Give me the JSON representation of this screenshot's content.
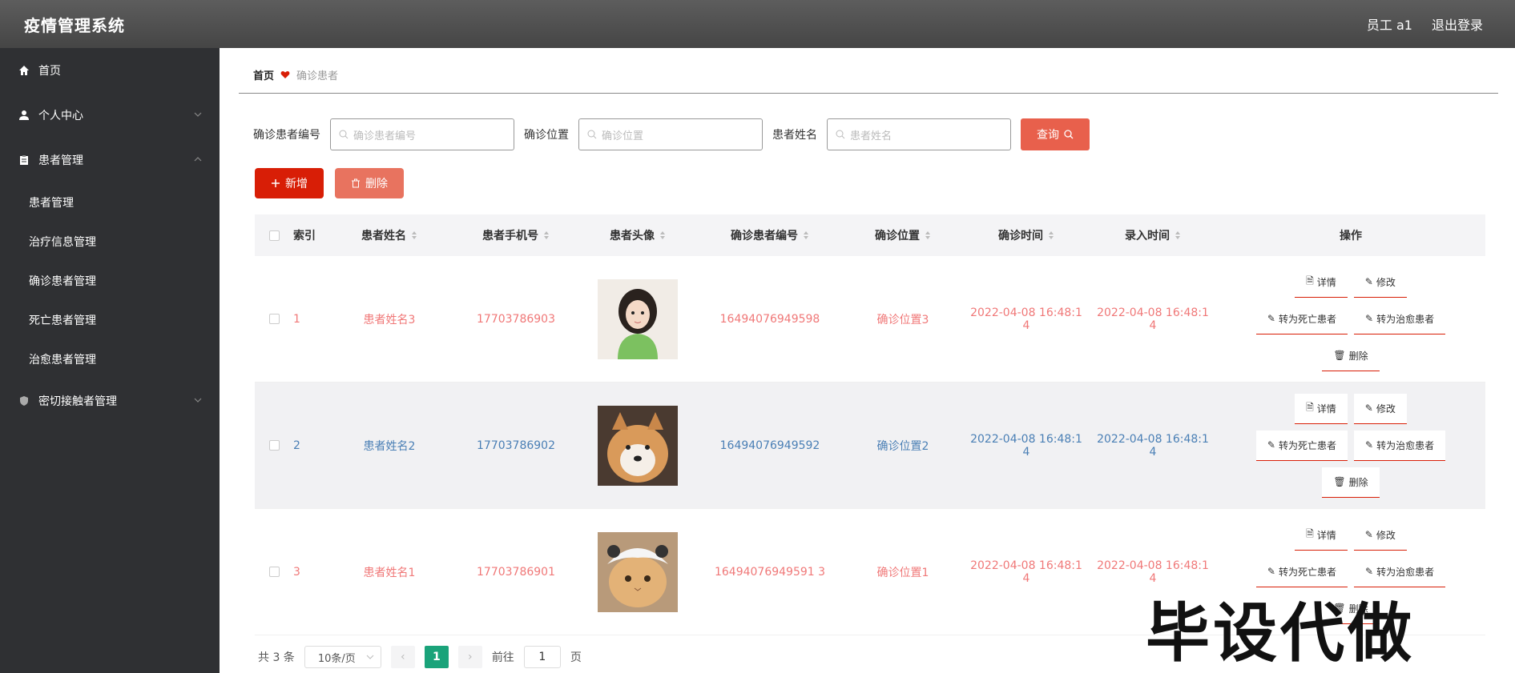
{
  "app": {
    "title": "疫情管理系统"
  },
  "header": {
    "user": "员工 a1",
    "logout": "退出登录"
  },
  "sidebar": {
    "items": [
      {
        "label": "首页",
        "icon": "home-icon"
      },
      {
        "label": "个人中心",
        "icon": "user-icon"
      },
      {
        "label": "患者管理",
        "icon": "clipboard-icon"
      },
      {
        "label": "密切接触者管理",
        "icon": "shield-icon"
      }
    ],
    "sub_items": [
      {
        "label": "患者管理"
      },
      {
        "label": "治疗信息管理"
      },
      {
        "label": "确诊患者管理"
      },
      {
        "label": "死亡患者管理"
      },
      {
        "label": "治愈患者管理"
      }
    ]
  },
  "breadcrumb": {
    "home": "首页",
    "current": "确诊患者"
  },
  "search": {
    "code_label": "确诊患者编号",
    "code_placeholder": "确诊患者编号",
    "loc_label": "确诊位置",
    "loc_placeholder": "确诊位置",
    "name_label": "患者姓名",
    "name_placeholder": "患者姓名",
    "query_label": "查询"
  },
  "actions": {
    "add_label": "新增",
    "delete_label": "删除"
  },
  "table": {
    "headers": {
      "index": "索引",
      "name": "患者姓名",
      "phone": "患者手机号",
      "avatar": "患者头像",
      "code": "确诊患者编号",
      "location": "确诊位置",
      "confirm_time": "确诊时间",
      "entry_time": "录入时间",
      "ops": "操作"
    },
    "rows": [
      {
        "index": "1",
        "name": "患者姓名3",
        "phone": "17703786903",
        "code": "16494076949598",
        "location": "确诊位置3",
        "time_line1": "2022-04-08 16:48:1",
        "time_line2": "4"
      },
      {
        "index": "2",
        "name": "患者姓名2",
        "phone": "17703786902",
        "code": "16494076949592",
        "location": "确诊位置2",
        "time_line1": "2022-04-08 16:48:1",
        "time_line2": "4"
      },
      {
        "index": "3",
        "name": "患者姓名1",
        "phone": "17703786901",
        "code": "16494076949591 3",
        "location": "确诊位置1",
        "time_line1": "2022-04-08 16:48:1",
        "time_line2": "4"
      }
    ],
    "ops": {
      "detail": "详情",
      "edit": "修改",
      "to_dead": "转为死亡患者",
      "to_cured": "转为治愈患者",
      "delete": "删除"
    }
  },
  "pagination": {
    "total": "共 3 条",
    "page_size": "10条/页",
    "current_page": "1",
    "goto_label": "前往",
    "goto_value": "1",
    "page_suffix": "页"
  },
  "watermark": "毕设代做",
  "colors": {
    "primary": "#d81e06",
    "accent": "#e8604c",
    "pager_active": "#1aa37a",
    "sidebar_bg": "#2f3033"
  }
}
